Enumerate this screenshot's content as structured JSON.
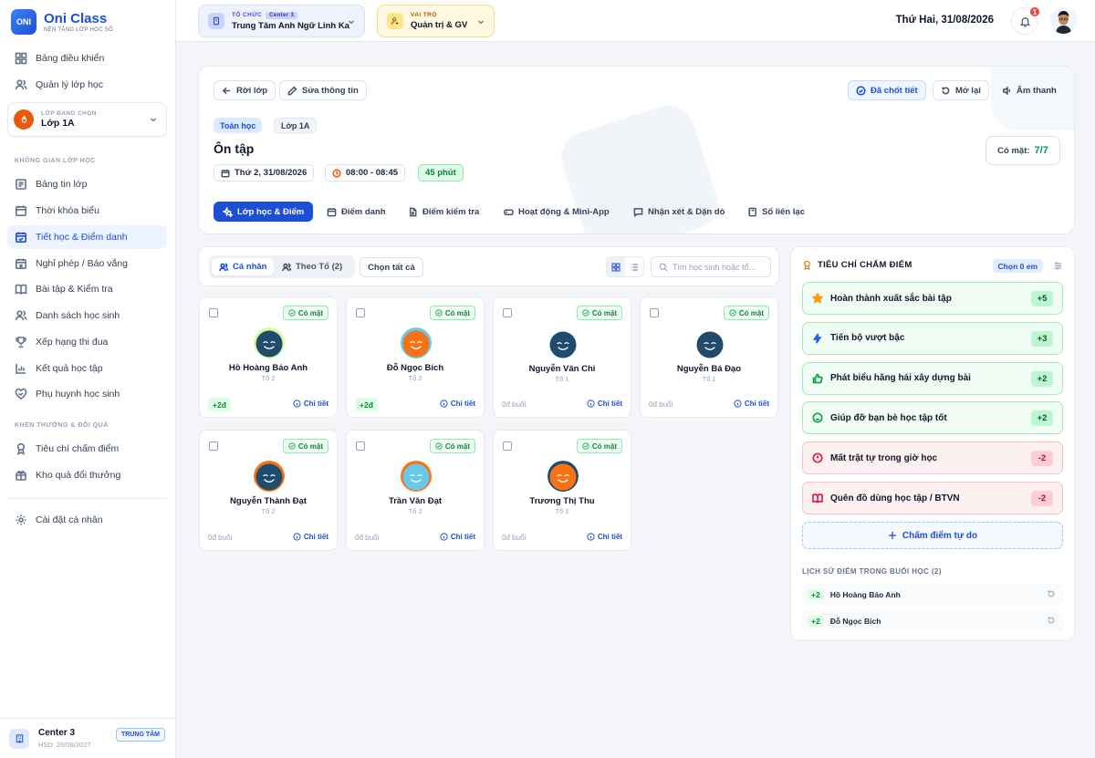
{
  "brand": {
    "name": "Oni Class",
    "tagline": "NỀN TẢNG LỚP HỌC SỐ",
    "logo_text": "ONI"
  },
  "sidebar": {
    "top_items": [
      {
        "label": "Bảng điều khiển",
        "icon": "dashboard-icon"
      },
      {
        "label": "Quản lý lớp học",
        "icon": "users-icon"
      }
    ],
    "class_select": {
      "sub": "LỚP ĐANG CHỌN",
      "name": "Lớp 1A"
    },
    "section_class": "KHÔNG GIAN LỚP HỌC",
    "class_items": [
      {
        "label": "Bảng tin lớp",
        "icon": "newspaper-icon"
      },
      {
        "label": "Thời khóa biểu",
        "icon": "calendar-icon"
      },
      {
        "label": "Tiết học & Điểm danh",
        "icon": "calendar-check-icon",
        "active": true
      },
      {
        "label": "Nghỉ phép / Báo vắng",
        "icon": "calendar-x-icon"
      },
      {
        "label": "Bài tập & Kiểm tra",
        "icon": "book-icon"
      },
      {
        "label": "Danh sách học sinh",
        "icon": "users-icon"
      },
      {
        "label": "Xếp hạng thi đua",
        "icon": "trophy-icon"
      },
      {
        "label": "Kết quả học tập",
        "icon": "bar-chart-icon"
      },
      {
        "label": "Phụ huynh học sinh",
        "icon": "heart-handshake-icon"
      }
    ],
    "section_rewards": "KHEN THƯỞNG & ĐỔI QUÀ",
    "reward_items": [
      {
        "label": "Tiêu chí chấm điểm",
        "icon": "award-icon"
      },
      {
        "label": "Kho quà đổi thưởng",
        "icon": "gift-icon"
      }
    ],
    "settings_label": "Cài đặt cá nhân",
    "footer": {
      "name": "Center 3",
      "expiry": "HSD: 26/08/2027",
      "badge": "TRUNG TÂM"
    }
  },
  "topbar": {
    "org_label": "TỔ CHỨC",
    "org_tag": "Center 3",
    "org_name": "Trung Tâm Anh Ngữ Linh Ka",
    "role_label": "VAI TRÒ",
    "role_name": "Quản trị & GV",
    "date": "Thứ Hai, 31/08/2026",
    "notification_count": "1"
  },
  "lesson": {
    "back_label": "Rời lớp",
    "edit_label": "Sửa thông tin",
    "locked_label": "Đã chốt tiết",
    "reopen_label": "Mở lại",
    "sound_label": "Âm thanh",
    "subject": "Toán học",
    "class_tag": "Lớp 1A",
    "title": "Ôn tập",
    "date": "Thứ 2, 31/08/2026",
    "time": "08:00 - 08:45",
    "duration": "45 phút",
    "present_label": "Có mặt:",
    "present_value": "7/7",
    "tabs": [
      {
        "label": "Lớp học & Điểm",
        "icon": "sparkles-icon",
        "active": true
      },
      {
        "label": "Điểm danh",
        "icon": "calendar-icon"
      },
      {
        "label": "Điểm kiểm tra",
        "icon": "file-text-icon"
      },
      {
        "label": "Hoạt động & Mini-App",
        "icon": "gamepad-icon"
      },
      {
        "label": "Nhận xét & Dặn dò",
        "icon": "message-icon"
      },
      {
        "label": "Sổ liên lạc",
        "icon": "notebook-icon"
      }
    ]
  },
  "students_panel": {
    "seg_individual": "Cá nhân",
    "seg_group": "Theo Tổ (2)",
    "select_all": "Chọn tất cả",
    "search_placeholder": "Tìm học sinh hoặc tổ...",
    "status_label": "Có mặt",
    "detail_label": "Chi tiết",
    "students": [
      {
        "name": "Hồ Hoàng Bảo Anh",
        "group": "Tổ 2",
        "points": "+2đ",
        "color": "#1e4b6e",
        "ring": "#d9f99d"
      },
      {
        "name": "Đỗ Ngọc Bích",
        "group": "Tổ 2",
        "points": "+2đ",
        "color": "#f97316",
        "ring": "#67c8e8"
      },
      {
        "name": "Nguyễn Văn Chi",
        "group": "Tổ 1",
        "points": "0đ buổi",
        "color": "#1e4b6e",
        "ring": "#ffffff"
      },
      {
        "name": "Nguyễn Bá Đạo",
        "group": "Tổ 1",
        "points": "0đ buổi",
        "color": "#1e4b6e",
        "ring": "#ffffff"
      },
      {
        "name": "Nguyễn Thành Đạt",
        "group": "Tổ 2",
        "points": "0đ buổi",
        "color": "#1e4b6e",
        "ring": "#f97316"
      },
      {
        "name": "Trần Văn Đạt",
        "group": "Tổ 2",
        "points": "0đ buổi",
        "color": "#67c8e8",
        "ring": "#f97316"
      },
      {
        "name": "Trương Thị Thu",
        "group": "Tổ 2",
        "points": "0đ buổi",
        "color": "#f97316",
        "ring": "#1e4b6e"
      }
    ]
  },
  "criteria_panel": {
    "title": "TIÊU CHÍ CHẤM ĐIỂM",
    "select_label": "Chọn 0 em",
    "items": [
      {
        "label": "Hoàn thành xuất sắc bài tập",
        "value": "+5",
        "type": "good",
        "icon": "star-icon"
      },
      {
        "label": "Tiến bộ vượt bậc",
        "value": "+3",
        "type": "good",
        "icon": "zap-icon"
      },
      {
        "label": "Phát biểu hăng hái xây dựng bài",
        "value": "+2",
        "type": "good",
        "icon": "thumbs-up-icon"
      },
      {
        "label": "Giúp đỡ bạn bè học tập tốt",
        "value": "+2",
        "type": "good",
        "icon": "smile-icon"
      },
      {
        "label": "Mất trật tự trong giờ học",
        "value": "-2",
        "type": "bad",
        "icon": "alert-circle-icon"
      },
      {
        "label": "Quên đồ dùng học tập / BTVN",
        "value": "-2",
        "type": "bad",
        "icon": "book-open-icon"
      }
    ],
    "free_score_label": "Chấm điểm tự do",
    "history_title": "LỊCH SỬ ĐIỂM TRONG BUỔI HỌC (2)",
    "history": [
      {
        "points": "+2",
        "name": "Hồ Hoàng Bảo Anh"
      },
      {
        "points": "+2",
        "name": "Đỗ Ngọc Bích"
      }
    ]
  }
}
